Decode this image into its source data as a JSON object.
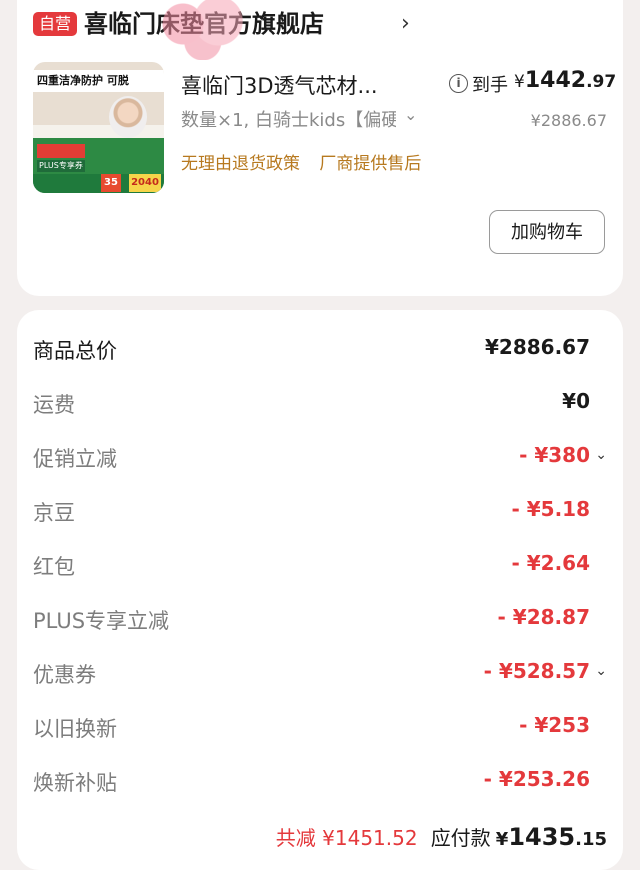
{
  "store": {
    "badge": "自营",
    "name": "喜临门床垫官方旗舰店",
    "chevron": "›"
  },
  "product": {
    "title": "喜临门3D透气芯材...",
    "spec": "数量×1, 白骑士kids【偏硬",
    "spec_chevron": "⌄",
    "tags": [
      "无理由退货政策",
      "厂商提供售后"
    ],
    "price_label": "到手",
    "price_currency": "¥",
    "price_int": "1442",
    "price_dec": ".97",
    "orig_price": "¥2886.67",
    "add_cart": "加购物车",
    "thumbnail": {
      "headline": "四重洁净防护 可脱",
      "plus": "PLUS专享券",
      "badge_35": "35",
      "badge_2040": "2040"
    }
  },
  "summary": {
    "rows": [
      {
        "label": "商品总价",
        "value": "¥2886.67"
      },
      {
        "label": "运费",
        "value": "¥0"
      },
      {
        "label": "促销立减",
        "value": "- ¥380"
      },
      {
        "label": "京豆",
        "value": "- ¥5.18"
      },
      {
        "label": "红包",
        "value": "- ¥2.64"
      },
      {
        "label": "PLUS专享立减",
        "value": "- ¥28.87"
      },
      {
        "label": "优惠券",
        "value": "- ¥528.57"
      },
      {
        "label": "以旧换新",
        "value": "- ¥253"
      },
      {
        "label": "焕新补贴",
        "value": "- ¥253.26"
      }
    ],
    "row_chevron": "⌄",
    "total_saved": "共减 ¥1451.52",
    "pay_label": "应付款",
    "pay_currency": "¥",
    "pay_int": "1435",
    "pay_dec": ".15"
  },
  "colors": {
    "accent_red": "#e4393c",
    "tag_gold": "#b7791f",
    "background": "#f3efee"
  },
  "icons": [
    "info-icon",
    "chevron-right-icon",
    "chevron-down-icon"
  ]
}
